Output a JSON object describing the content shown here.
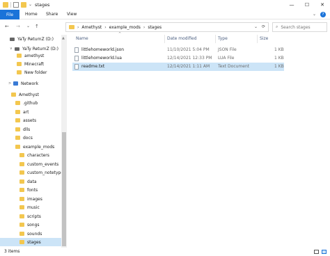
{
  "window": {
    "title": "stages",
    "controls": [
      "—",
      "☐",
      "✕"
    ]
  },
  "ribbon": {
    "file": "File",
    "tabs": [
      "Home",
      "Share",
      "View"
    ],
    "help": "?"
  },
  "nav": {
    "back": "←",
    "forward": "→",
    "history": "⌄",
    "up": "↑",
    "refresh": "⟳",
    "history2": "⌄"
  },
  "breadcrumbs": [
    "Amethyst",
    "example_mods",
    "stages"
  ],
  "search": {
    "placeholder": "Search stages",
    "icon": "⌕"
  },
  "sidebar": [
    {
      "label": "YaTy ReturnZ (D:)",
      "type": "drive"
    },
    {
      "label": "YaTy ReturnZ (D:)",
      "type": "drive",
      "expander": "∨"
    },
    {
      "label": "amethyst",
      "type": "folder"
    },
    {
      "label": "Minecraft",
      "type": "folder"
    },
    {
      "label": "New folder",
      "type": "folder"
    },
    {
      "label": "Network",
      "type": "network",
      "expander": ">"
    },
    {
      "label": "Amethyst",
      "type": "folder"
    },
    {
      "label": ".github",
      "type": "folder"
    },
    {
      "label": "art",
      "type": "folder"
    },
    {
      "label": "assets",
      "type": "folder"
    },
    {
      "label": "dlls",
      "type": "folder"
    },
    {
      "label": "docs",
      "type": "folder"
    },
    {
      "label": "example_mods",
      "type": "folder"
    },
    {
      "label": "characters",
      "type": "folder"
    },
    {
      "label": "custom_events",
      "type": "folder"
    },
    {
      "label": "custom_notetypes",
      "type": "folder"
    },
    {
      "label": "data",
      "type": "folder"
    },
    {
      "label": "fonts",
      "type": "folder"
    },
    {
      "label": "images",
      "type": "folder"
    },
    {
      "label": "music",
      "type": "folder"
    },
    {
      "label": "scripts",
      "type": "folder"
    },
    {
      "label": "songs",
      "type": "folder"
    },
    {
      "label": "sounds",
      "type": "folder"
    },
    {
      "label": "stages",
      "type": "folder",
      "selected": true
    }
  ],
  "columns": {
    "name": "Name",
    "date": "Date modified",
    "type": "Type",
    "size": "Size",
    "sort_arrow": "^"
  },
  "files": [
    {
      "name": "littlehomeworld.json",
      "date": "11/10/2021 5:04 PM",
      "type": "JSON File",
      "size": "1 KB"
    },
    {
      "name": "littlehomeworld.lua",
      "date": "12/14/2021 12:33 PM",
      "type": "LUA File",
      "size": "1 KB"
    },
    {
      "name": "readme.txt",
      "date": "12/14/2021 1:11 AM",
      "type": "Text Document",
      "size": "1 KB",
      "selected": true
    }
  ],
  "status": {
    "count": "3 items"
  },
  "colors": {
    "accent": "#1a73d9",
    "selection": "#cce4f7",
    "folder": "#f3c74f"
  }
}
